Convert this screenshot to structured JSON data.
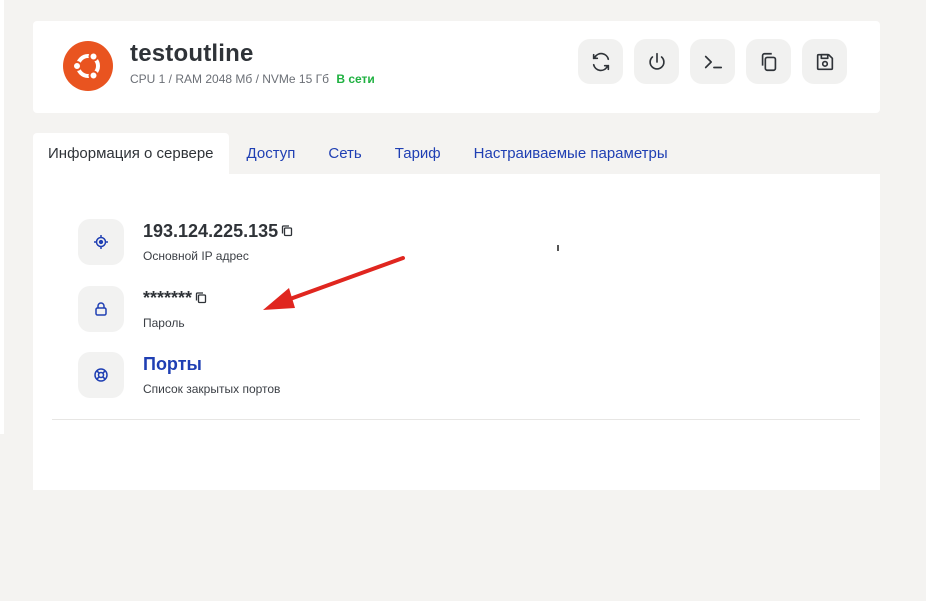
{
  "server": {
    "name": "testoutline",
    "specs": "CPU 1 / RAM 2048 Мб / NVMe 15 Гб",
    "status": "В сети",
    "os_icon": "ubuntu-logo-icon"
  },
  "toolbar": [
    {
      "name": "reboot-button",
      "icon": "refresh-icon"
    },
    {
      "name": "power-button",
      "icon": "power-icon"
    },
    {
      "name": "console-button",
      "icon": "terminal-icon"
    },
    {
      "name": "clone-button",
      "icon": "copy-icon"
    },
    {
      "name": "backup-button",
      "icon": "save-icon"
    }
  ],
  "tabs": [
    {
      "label": "Информация о сервере",
      "active": true
    },
    {
      "label": "Доступ"
    },
    {
      "label": "Сеть"
    },
    {
      "label": "Тариф"
    },
    {
      "label": "Настраиваемые параметры"
    }
  ],
  "info": {
    "ip": {
      "value": "193.124.225.135",
      "label": "Основной IP адрес",
      "icon": "target-icon"
    },
    "password": {
      "value": "*******",
      "label": "Пароль",
      "icon": "lock-icon"
    },
    "ports": {
      "value": "Порты",
      "label": "Список закрытых портов",
      "icon": "lifebuoy-icon"
    }
  },
  "colors": {
    "accent": "#1f3fb3",
    "status_online": "#1fb141",
    "ubuntu_orange": "#e95420",
    "annotation_arrow": "#e0261f"
  }
}
